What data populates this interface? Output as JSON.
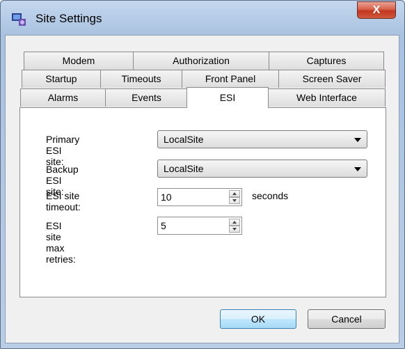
{
  "window": {
    "title": "Site Settings",
    "close_glyph": "X",
    "icon": "app-settings-icon"
  },
  "tabs": {
    "row1": [
      "Modem",
      "Authorization",
      "Captures"
    ],
    "row2": [
      "Startup",
      "Timeouts",
      "Front Panel",
      "Screen Saver"
    ],
    "row3": [
      "Alarms",
      "Events",
      "ESI",
      "Web Interface"
    ],
    "active": "ESI"
  },
  "esi": {
    "primary_label": "Primary ESI site:",
    "primary_value": "LocalSite",
    "backup_label": "Backup ESI site:",
    "backup_value": "LocalSite",
    "timeout_label": "ESI site timeout:",
    "timeout_value": "10",
    "timeout_unit": "seconds",
    "retries_label": "ESI site max retries:",
    "retries_value": "5"
  },
  "buttons": {
    "ok": "OK",
    "cancel": "Cancel"
  }
}
